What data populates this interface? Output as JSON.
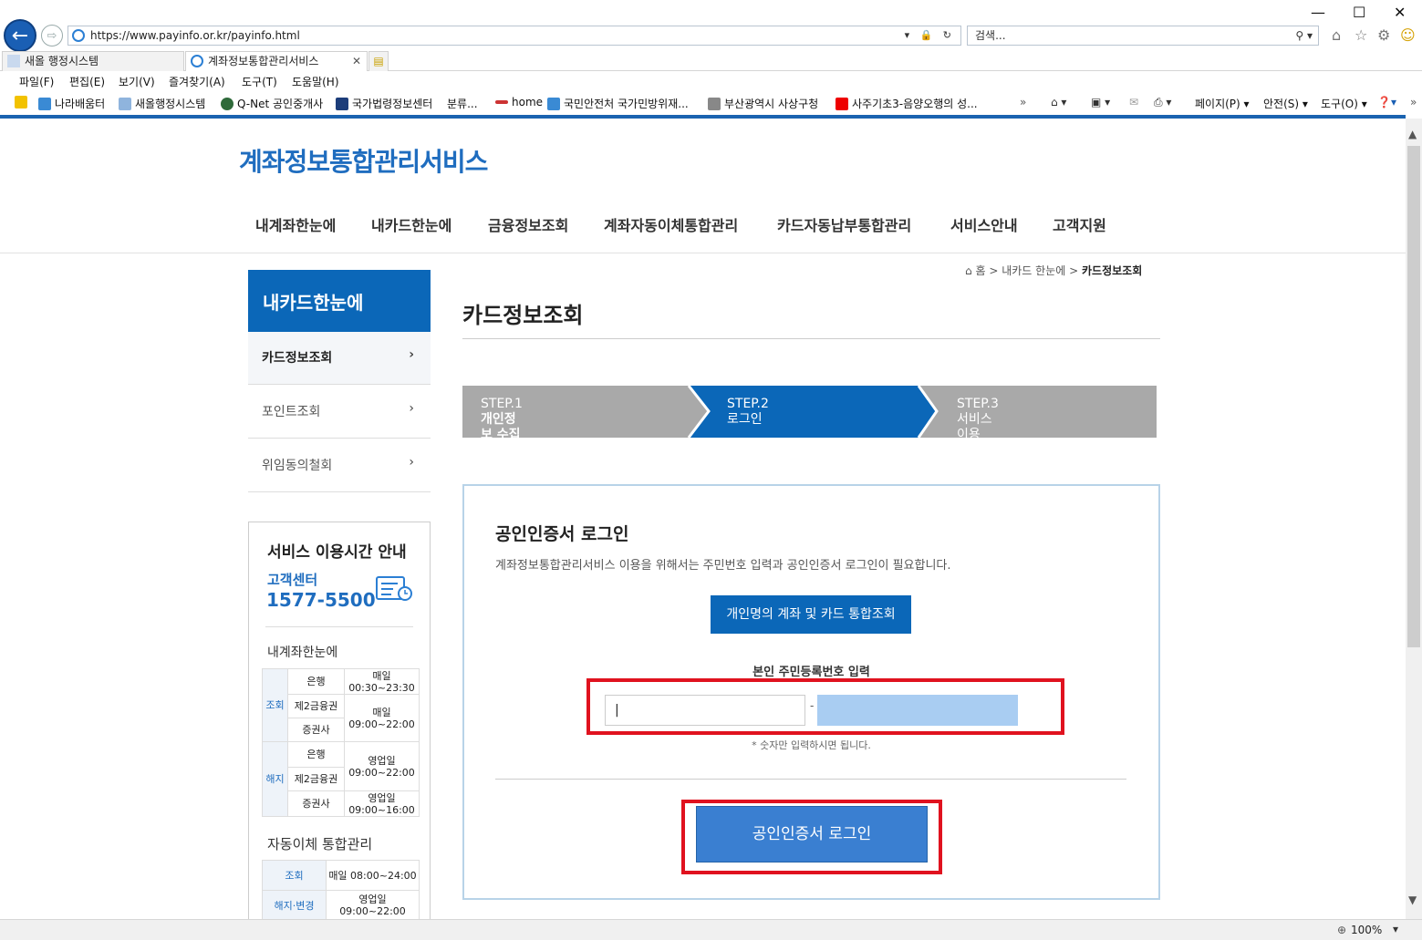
{
  "browser": {
    "url": "https://www.payinfo.or.kr/payinfo.html",
    "search_placeholder": "검색...",
    "tabs": [
      {
        "label": "새올 행정시스템"
      },
      {
        "label": "계좌정보통합관리서비스"
      }
    ],
    "menu": [
      "파일(F)",
      "편집(E)",
      "보기(V)",
      "즐겨찾기(A)",
      "도구(T)",
      "도움말(H)"
    ],
    "favorites": [
      "나라배움터",
      "새올행정시스템",
      "Q-Net 공인중개사",
      "국가법령정보센터",
      "분류...",
      "home",
      "국민안전처 국가민방위재...",
      "부산광역시 사상구청",
      "사주기초3-음양오행의 성..."
    ],
    "command_bar": [
      "페이지(P)",
      "안전(S)",
      "도구(O)"
    ],
    "zoom": "100%"
  },
  "site": {
    "logo": "계좌정보통합관리서비스",
    "gnb": [
      "내계좌한눈에",
      "내카드한눈에",
      "금융정보조회",
      "계좌자동이체통합관리",
      "카드자동납부통합관리",
      "서비스안내",
      "고객지원"
    ],
    "breadcrumb": {
      "home": "홈",
      "sep": ">",
      "level1": "내카드 한눈에",
      "current": "카드정보조회"
    }
  },
  "lnb": {
    "title": "내카드한눈에",
    "items": [
      {
        "label": "카드정보조회",
        "active": true
      },
      {
        "label": "포인트조회",
        "active": false
      },
      {
        "label": "위임동의철회",
        "active": false
      }
    ],
    "arrow": "›"
  },
  "service_hours": {
    "title": "서비스 이용시간 안내",
    "center_label": "고객센터",
    "phone": "1577-5500",
    "account_title": "내계좌한눈에",
    "account_rows": {
      "inquiry_label": "조회",
      "cancel_label": "해지",
      "bank": "은행",
      "second_fin": "제2금융권",
      "securities": "증권사",
      "inq_bank_day": "매일",
      "inq_bank_time": "00:30~23:30",
      "inq_other_day": "매일",
      "inq_other_time": "09:00~22:00",
      "can_bank_day": "영업일",
      "can_bank_time": "09:00~22:00",
      "can_sec_day": "영업일",
      "can_sec_time": "09:00~16:00"
    },
    "auto_title": "자동이체 통합관리",
    "auto_rows": [
      {
        "label": "조회",
        "value": "매일 08:00~24:00"
      },
      {
        "label": "해지·변경",
        "value": "영업일 09:00~22:00"
      }
    ]
  },
  "content": {
    "title": "카드정보조회",
    "steps": [
      {
        "num": "STEP.1",
        "label": "개인정보 수집 및 이용동의",
        "active": false
      },
      {
        "num": "STEP.2",
        "label": "로그인",
        "active": true
      },
      {
        "num": "STEP.3",
        "label": "서비스 이용",
        "active": false
      }
    ],
    "login": {
      "title": "공인인증서 로그인",
      "desc": "계좌정보통합관리서비스 이용을 위해서는 주민번호 입력과 공인인증서 로그인이 필요합니다.",
      "integrated_button": "개인명의 계좌 및 카드 통합조회",
      "rrn_label": "본인 주민등록번호 입력",
      "rrn_front_value": "|",
      "rrn_separator": "-",
      "rrn_note": "* 숫자만 입력하시면 됩니다.",
      "login_button": "공인인증서 로그인"
    }
  },
  "colors": {
    "primary": "#0b67b8",
    "step_inactive": "#a9a9a9",
    "highlight": "#e0121f",
    "login_button": "#3a7fd1"
  }
}
